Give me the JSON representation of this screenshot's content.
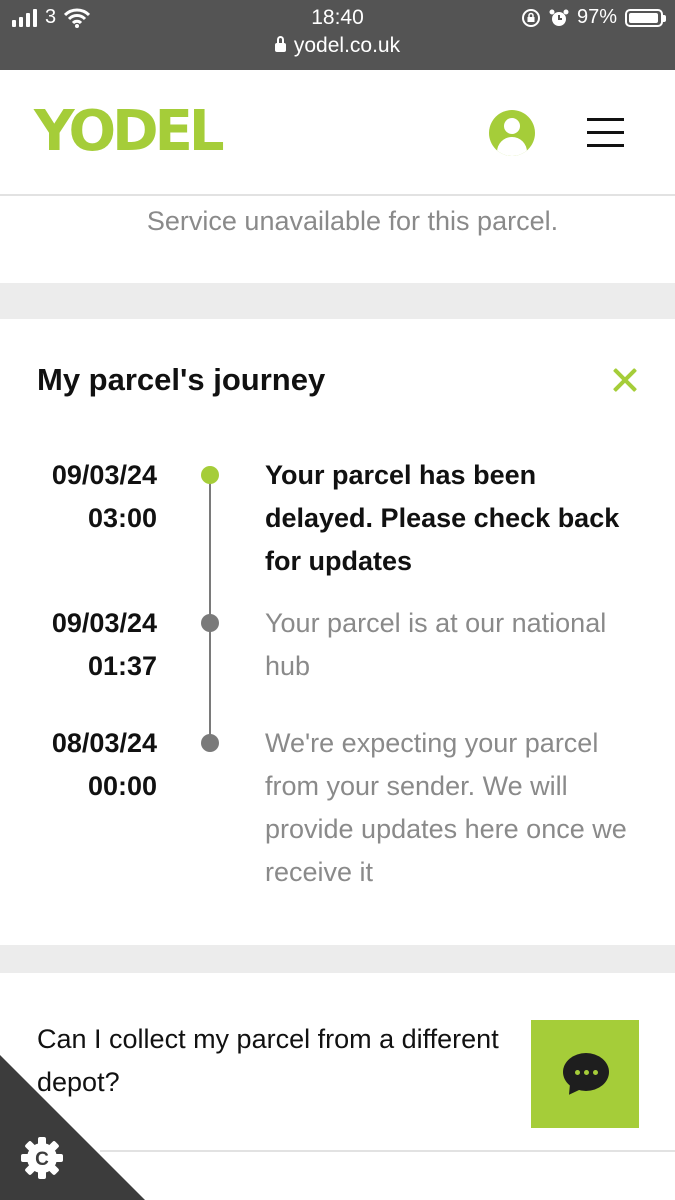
{
  "status_bar": {
    "carrier": "3",
    "time": "18:40",
    "battery": "97%",
    "battery_level": 0.97,
    "url": "yodel.co.uk"
  },
  "header": {
    "logo": "YODEL",
    "brand_color": "#a5cd39"
  },
  "service_message": "Service unavailable for this parcel.",
  "journey": {
    "title": "My parcel's journey",
    "events": [
      {
        "date": "09/03/24",
        "time": "03:00",
        "text": "Your parcel has been delayed. Please check back for updates",
        "active": true
      },
      {
        "date": "09/03/24",
        "time": "01:37",
        "text": "Your parcel is at our national hub",
        "active": false
      },
      {
        "date": "08/03/24",
        "time": "00:00",
        "text": "We're expecting your parcel from your sender. We will provide updates here once we receive it",
        "active": false
      }
    ]
  },
  "faq": {
    "question": "Can I collect my parcel from a different depot?"
  },
  "icons": {
    "account": "account-icon",
    "menu": "hamburger-menu-icon",
    "close": "close-icon",
    "chat": "chat-icon",
    "cookie": "cookie-settings-icon"
  }
}
